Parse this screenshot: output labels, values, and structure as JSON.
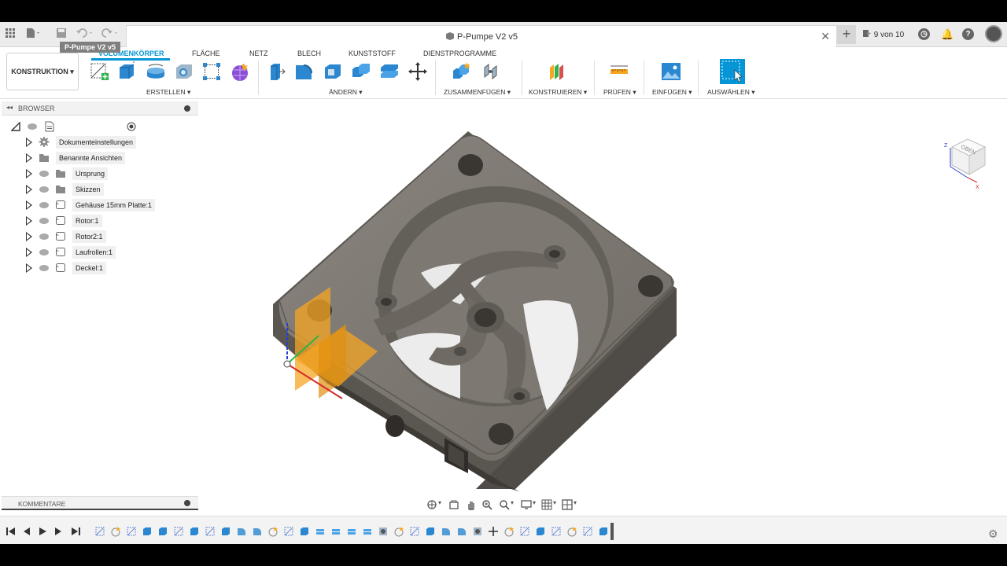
{
  "app": {
    "document_title": "P-Pumpe V2 v5",
    "jobs_label": "9 von 10"
  },
  "toolbar": {
    "workspace_label": "KONSTRUKTION",
    "tabs": [
      {
        "label": "VOLUMENKÖRPER",
        "active": true
      },
      {
        "label": "FLÄCHE",
        "active": false
      },
      {
        "label": "NETZ",
        "active": false
      },
      {
        "label": "BLECH",
        "active": false
      },
      {
        "label": "KUNSTSTOFF",
        "active": false
      },
      {
        "label": "DIENSTPROGRAMME",
        "active": false
      }
    ],
    "groups": [
      {
        "label": "ERSTELLEN"
      },
      {
        "label": "ÄNDERN"
      },
      {
        "label": "ZUSAMMENFÜGEN"
      },
      {
        "label": "KONSTRUIEREN"
      },
      {
        "label": "PRÜFEN"
      },
      {
        "label": "EINFÜGEN"
      },
      {
        "label": "AUSWÄHLEN"
      }
    ],
    "accent_color": "#0696d7"
  },
  "browser": {
    "header": "BROWSER",
    "root": "P-Pumpe V2 v5",
    "items": [
      {
        "label": "Dokumenteinstellungen",
        "icon": "gear-icon"
      },
      {
        "label": "Benannte Ansichten",
        "icon": "folder-icon"
      },
      {
        "label": "Ursprung",
        "icon": "folder-icon"
      },
      {
        "label": "Skizzen",
        "icon": "folder-icon"
      },
      {
        "label": "Gehäuse 15mm Platte:1",
        "icon": "component-icon"
      },
      {
        "label": "Rotor:1",
        "icon": "component-icon"
      },
      {
        "label": "Rotor2:1",
        "icon": "component-icon"
      },
      {
        "label": "Laufrollen:1",
        "icon": "component-icon"
      },
      {
        "label": "Deckel:1",
        "icon": "component-icon"
      }
    ]
  },
  "comments": {
    "header": "KOMMENTARE"
  },
  "viewcube": {
    "face_label": "OBEN",
    "axis_z": "Z",
    "axis_x": "X"
  },
  "model": {
    "body_color": "#7a756e",
    "plane_color": "#f5a623"
  }
}
